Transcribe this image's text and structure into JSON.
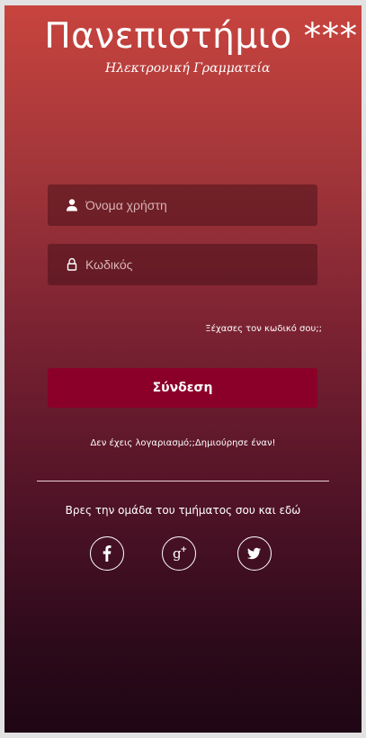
{
  "header": {
    "title": "Πανεπιστήμιο ***",
    "subtitle": "Ηλεκτρονική Γραμματεία"
  },
  "login": {
    "username_placeholder": "Όνομα χρήστη",
    "password_placeholder": "Κωδικός",
    "forgot_link": "Ξέχασες τον κωδικό σου;;",
    "submit_label": "Σύνδεση"
  },
  "signup": {
    "prompt": "Δεν έχεις λογαριασμό;;",
    "link": "Δημιούρησε έναν!"
  },
  "social": {
    "heading": "Βρες την ομάδα του τμήματος σου και εδώ",
    "icons": [
      "facebook-icon",
      "google-plus-icon",
      "twitter-icon"
    ]
  },
  "colors": {
    "gradient_top": "#c8443e",
    "gradient_bottom": "#1f0614",
    "button": "#8b0029"
  }
}
